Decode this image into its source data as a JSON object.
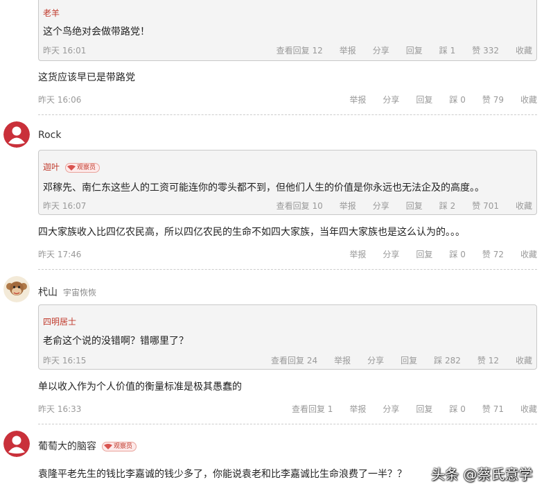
{
  "c0": {
    "quote": {
      "author": "老羊",
      "text": "这个鸟绝对会做带路党！",
      "time": "昨天 16:01",
      "actions": [
        "查看回复 12",
        "举报",
        "分享",
        "回复",
        "踩 1",
        "赞 332",
        "收藏"
      ]
    },
    "text": "这货应该早已是带路党",
    "time": "昨天 16:06",
    "actions": [
      "举报",
      "分享",
      "回复",
      "踩 0",
      "赞 79",
      "收藏"
    ]
  },
  "c1": {
    "user": "Rock",
    "quote": {
      "author": "迦叶",
      "badge": "观察员",
      "text": "邓稼先、南仁东这些人的工资可能连你的零头都不到，但他们人生的价值是你永远也无法企及的高度。。",
      "time": "昨天 16:07",
      "actions": [
        "查看回复 10",
        "举报",
        "分享",
        "回复",
        "踩 2",
        "赞 701",
        "收藏"
      ]
    },
    "text": "四大家族收入比四亿农民高，所以四亿农民的生命不如四大家族，当年四大家族也是这么认为的。。。",
    "time": "昨天 17:46",
    "actions": [
      "举报",
      "分享",
      "回复",
      "踩 0",
      "赞 72",
      "收藏"
    ]
  },
  "c2": {
    "user": "杙山",
    "user_sub": "宇宙恢恢",
    "quote": {
      "author": "四明居士",
      "text": "老俞这个说的没错啊？错哪里了？",
      "time": "昨天 16:15",
      "actions": [
        "查看回复 24",
        "举报",
        "分享",
        "回复",
        "踩 282",
        "赞 12",
        "收藏"
      ]
    },
    "text": "单以收入作为个人价值的衡量标准是极其愚蠢的",
    "time": "昨天 16:33",
    "actions": [
      "查看回复 1",
      "举报",
      "分享",
      "回复",
      "踩 0",
      "赞 71",
      "收藏"
    ]
  },
  "c3": {
    "user": "葡萄大的脑容",
    "badge": "观察员",
    "text": "袁隆平老先生的钱比李嘉诚的钱少多了，你能说袁老和比李嘉诚比生命浪费了一半？？"
  },
  "watermark": "头条 @蔡氏意学",
  "colors": {
    "accent_red": "#c0392b",
    "meta_gray": "#999999",
    "quote_bg": "#f4f4f4"
  }
}
